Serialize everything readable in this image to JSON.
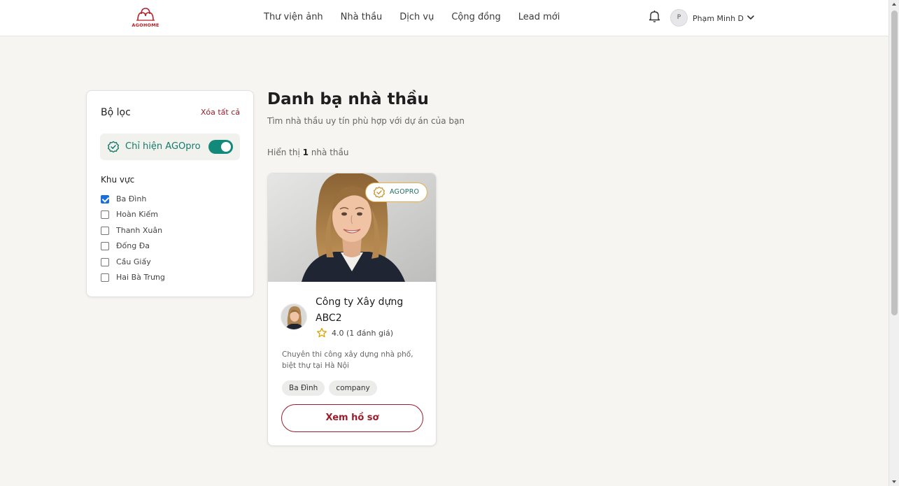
{
  "brand": {
    "name": "AGOHOME",
    "accent": "#9b1c2a",
    "teal": "#13897a",
    "gold": "#e3b04b"
  },
  "header": {
    "nav": [
      "Thư viện ảnh",
      "Nhà thầu",
      "Dịch vụ",
      "Cộng đồng",
      "Lead mới"
    ],
    "user": {
      "initial": "P",
      "name": "Phạm Minh D"
    }
  },
  "filters": {
    "title": "Bộ lọc",
    "clear_label": "Xóa tất cả",
    "agopro_label": "Chỉ hiện AGOpro",
    "agopro_enabled": true,
    "area_title": "Khu vực",
    "areas": [
      {
        "label": "Ba Đình",
        "checked": true
      },
      {
        "label": "Hoàn Kiếm",
        "checked": false
      },
      {
        "label": "Thanh Xuân",
        "checked": false
      },
      {
        "label": "Đống Đa",
        "checked": false
      },
      {
        "label": "Cầu Giấy",
        "checked": false
      },
      {
        "label": "Hai Bà Trưng",
        "checked": false
      }
    ]
  },
  "main": {
    "title": "Danh bạ nhà thầu",
    "subtitle": "Tìm nhà thầu uy tín phù hợp với dự án của bạn",
    "count_prefix": "Hiển thị",
    "count_value": "1",
    "count_suffix": "nhà thầu"
  },
  "contractors": [
    {
      "badge": "AGOPRO",
      "name": "Công ty Xây dựng ABC2",
      "rating": "4.0 (1 đánh giá)",
      "description": "Chuyên thi công xây dựng nhà phố, biệt thự tại Hà Nội",
      "tags": [
        "Ba Đình",
        "company"
      ],
      "button_label": "Xem hồ sơ"
    }
  ]
}
